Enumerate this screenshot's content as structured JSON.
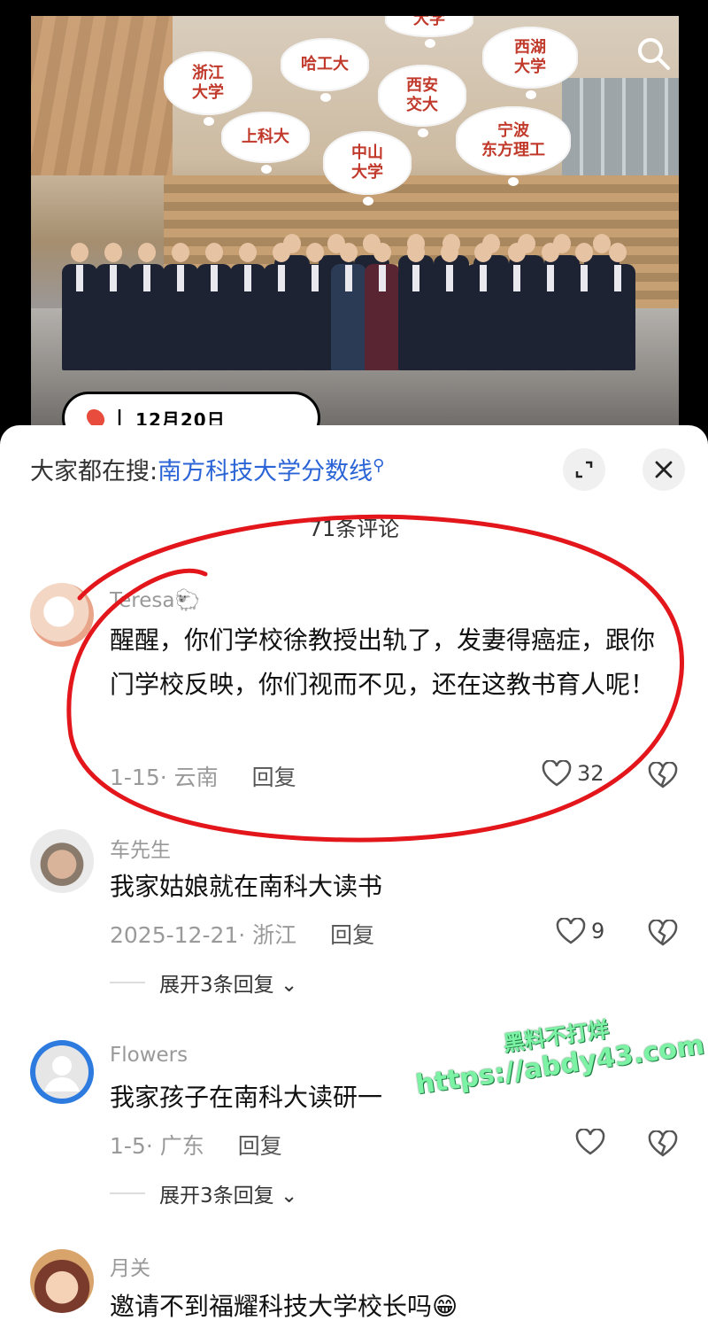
{
  "video": {
    "bubbles": [
      "浙江\n大学",
      "哈工大",
      "西安\n交大",
      "西湖\n大学",
      "上科大",
      "中山\n大学",
      "宁波\n东方理工",
      "大学"
    ],
    "location_date": "12月20日",
    "colors": {
      "bubble_text": "#c0392b"
    }
  },
  "sheet": {
    "search_prefix": "大家都在搜:",
    "search_query": "南方科技大学分数线",
    "search_suffix_icon": "search-icon",
    "comment_count": "71条评论"
  },
  "comments": [
    {
      "user": "Teresa🐑",
      "text": "醒醒，你们学校徐教授出轨了，发妻得癌症，跟你门学校反映，你们视而不见，还在这教书育人呢！",
      "date_loc": "1-15· 云南",
      "reply": "回复",
      "likes": "32"
    },
    {
      "user": "车先生",
      "text": "我家姑娘就在南科大读书",
      "date_loc": "2025-12-21· 浙江",
      "reply": "回复",
      "likes": "9",
      "expand": "展开3条回复 ⌄"
    },
    {
      "user": "Flowers",
      "text": "我家孩子在南科大读研一",
      "date_loc": "1-5· 广东",
      "reply": "回复",
      "likes": "",
      "expand": "展开3条回复 ⌄"
    },
    {
      "user": "月关",
      "text": "邀请不到福耀科技大学校长吗😁"
    }
  ],
  "watermark": {
    "line1": "黑料不打烊",
    "line2": "https://abdy43.com"
  },
  "accent": {
    "link": "#2b64d6",
    "annotation": "#e3161c"
  }
}
